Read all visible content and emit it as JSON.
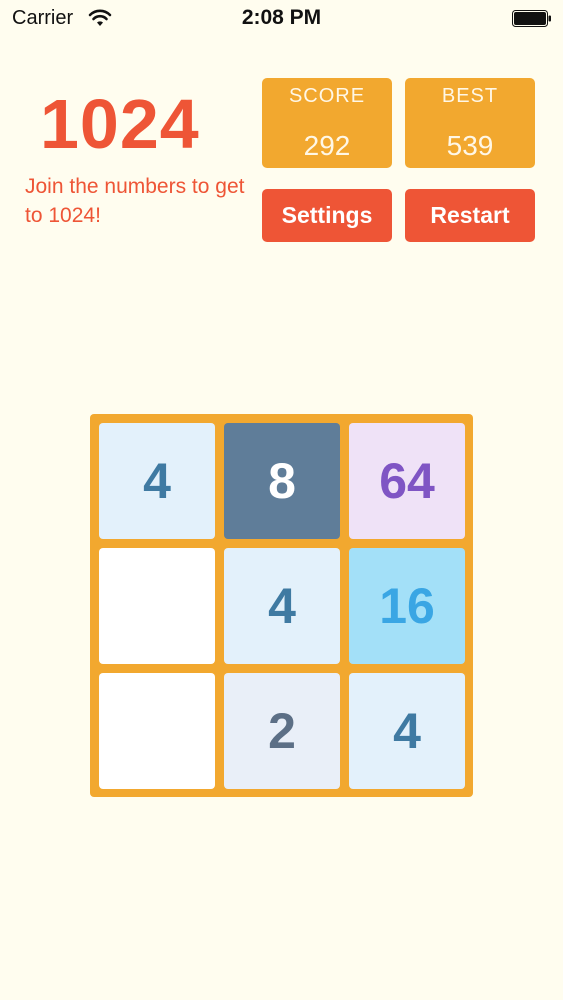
{
  "status_bar": {
    "carrier": "Carrier",
    "time": "2:08 PM"
  },
  "header": {
    "title": "1024",
    "subtitle": "Join the numbers to get to 1024!"
  },
  "scores": {
    "score_label": "SCORE",
    "score_value": "292",
    "best_label": "BEST",
    "best_value": "539"
  },
  "buttons": {
    "settings": "Settings",
    "restart": "Restart"
  },
  "board": {
    "rows": [
      [
        "4",
        "8",
        "64"
      ],
      [
        "",
        "4",
        "16"
      ],
      [
        "",
        "2",
        "4"
      ]
    ]
  },
  "colors": {
    "accent": "#ee5536",
    "board": "#f2a82f",
    "background": "#fffdef"
  }
}
